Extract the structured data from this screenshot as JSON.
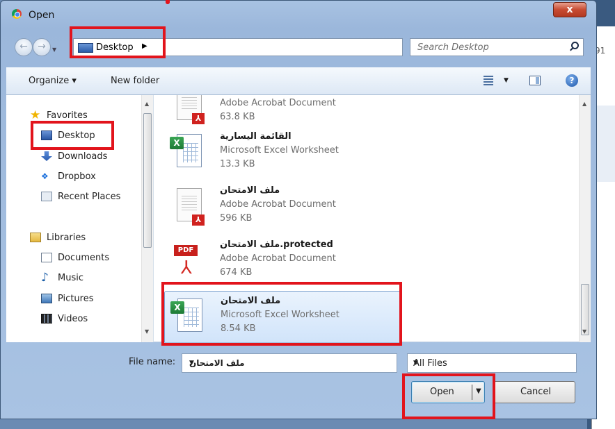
{
  "window": {
    "title": "Open"
  },
  "nav": {
    "address": "Desktop",
    "search_placeholder": "Search Desktop",
    "background_text": "91"
  },
  "toolbar": {
    "organize": "Organize ▾",
    "new_folder": "New folder"
  },
  "sidebar": {
    "favorites": "Favorites",
    "desktop": "Desktop",
    "downloads": "Downloads",
    "dropbox": "Dropbox",
    "recent": "Recent Places",
    "libraries": "Libraries",
    "documents": "Documents",
    "music": "Music",
    "pictures": "Pictures",
    "videos": "Videos"
  },
  "files": [
    {
      "name": "",
      "type": "Adobe Acrobat Document",
      "size": "63.8 KB",
      "icon": "pdf-document-icon"
    },
    {
      "name": "القائمة اليسارية",
      "type": "Microsoft Excel Worksheet",
      "size": "13.3 KB",
      "icon": "excel-icon"
    },
    {
      "name": "ملف الامتحان",
      "type": "Adobe Acrobat Document",
      "size": "596 KB",
      "icon": "pdf-document-icon"
    },
    {
      "name": "ملف الامتحان.protected",
      "type": "Adobe Acrobat Document",
      "size": "674 KB",
      "icon": "pdf-icon"
    },
    {
      "name": "ملف الامتحان",
      "type": "Microsoft Excel Worksheet",
      "size": "8.54 KB",
      "icon": "excel-icon",
      "selected": true
    }
  ],
  "footer": {
    "file_name_label": "File name:",
    "file_name_value": "ملف الامتحان",
    "filter": "All Files",
    "open": "Open",
    "cancel": "Cancel"
  },
  "colors": {
    "highlight": "#e2141c",
    "selection": "#cfe3fa",
    "chrome": "#a8c2e2"
  }
}
